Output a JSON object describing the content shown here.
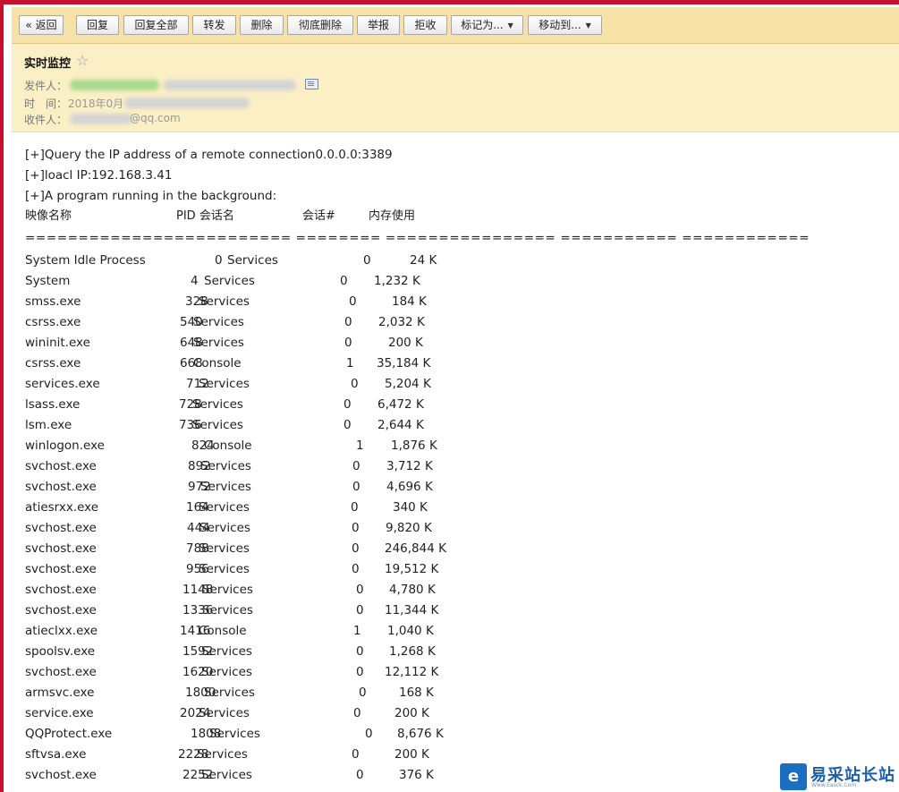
{
  "toolbar": {
    "back_label": "« 返回",
    "reply_label": "回复",
    "reply_all_label": "回复全部",
    "forward_label": "转发",
    "delete_label": "删除",
    "perm_delete_label": "彻底删除",
    "report_label": "举报",
    "reject_label": "拒收",
    "mark_as_label": "标记为...",
    "move_to_label": "移动到..."
  },
  "mail": {
    "subject": "实时监控",
    "star_icon": "☆",
    "from_label": "发件人：",
    "time_label": "时　间：",
    "time_value_visible": "2018年0月",
    "to_label": "收件人：",
    "to_value_visible": "@qq.com"
  },
  "body": {
    "line1": "[+]Query the IP address of a remote connection0.0.0.0:3389",
    "line2": "[+]loacl IP:192.168.3.41",
    "line3": "[+]A program running in the background:",
    "table_headers": {
      "image": "映像名称",
      "pid_session": "PID 会话名",
      "session_no": "会话#",
      "mem": "内存使用"
    },
    "separator": "========================= ======== ================ =========== ============",
    "processes": [
      {
        "name": "System Idle Process",
        "pid": "0",
        "session": "Services",
        "num": "0",
        "mem": "24 K"
      },
      {
        "name": "System",
        "pid": "4",
        "session": "Services",
        "num": "0",
        "mem": "1,232 K"
      },
      {
        "name": "smss.exe",
        "pid": "328",
        "session": "Services",
        "num": "0",
        "mem": "184 K"
      },
      {
        "name": "csrss.exe",
        "pid": "540",
        "session": "Services",
        "num": "0",
        "mem": "2,032 K"
      },
      {
        "name": "wininit.exe",
        "pid": "648",
        "session": "Services",
        "num": "0",
        "mem": "200 K"
      },
      {
        "name": "csrss.exe",
        "pid": "668",
        "session": "Console",
        "num": "1",
        "mem": "35,184 K"
      },
      {
        "name": "services.exe",
        "pid": "712",
        "session": "Services",
        "num": "0",
        "mem": "5,204 K"
      },
      {
        "name": "lsass.exe",
        "pid": "728",
        "session": "Services",
        "num": "0",
        "mem": "6,472 K"
      },
      {
        "name": "lsm.exe",
        "pid": "736",
        "session": "Services",
        "num": "0",
        "mem": "2,644 K"
      },
      {
        "name": "winlogon.exe",
        "pid": "824",
        "session": "Console",
        "num": "1",
        "mem": "1,876 K"
      },
      {
        "name": "svchost.exe",
        "pid": "892",
        "session": "Services",
        "num": "0",
        "mem": "3,712 K"
      },
      {
        "name": "svchost.exe",
        "pid": "972",
        "session": "Services",
        "num": "0",
        "mem": "4,696 K"
      },
      {
        "name": "atiesrxx.exe",
        "pid": "164",
        "session": "Services",
        "num": "0",
        "mem": "340 K"
      },
      {
        "name": "svchost.exe",
        "pid": "444",
        "session": "Services",
        "num": "0",
        "mem": "9,820 K"
      },
      {
        "name": "svchost.exe",
        "pid": "788",
        "session": "Services",
        "num": "0",
        "mem": "246,844 K"
      },
      {
        "name": "svchost.exe",
        "pid": "956",
        "session": "Services",
        "num": "0",
        "mem": "19,512 K"
      },
      {
        "name": "svchost.exe",
        "pid": "1148",
        "session": "Services",
        "num": "0",
        "mem": "4,780 K"
      },
      {
        "name": "svchost.exe",
        "pid": "1336",
        "session": "Services",
        "num": "0",
        "mem": "11,344 K"
      },
      {
        "name": "atieclxx.exe",
        "pid": "1416",
        "session": "Console",
        "num": "1",
        "mem": "1,040 K"
      },
      {
        "name": "spoolsv.exe",
        "pid": "1592",
        "session": "Services",
        "num": "0",
        "mem": "1,268 K"
      },
      {
        "name": "svchost.exe",
        "pid": "1620",
        "session": "Services",
        "num": "0",
        "mem": "12,112 K"
      },
      {
        "name": "armsvc.exe",
        "pid": "1800",
        "session": "Services",
        "num": "0",
        "mem": "168 K"
      },
      {
        "name": "service.exe",
        "pid": "2024",
        "session": "Services",
        "num": "0",
        "mem": "200 K"
      },
      {
        "name": "QQProtect.exe",
        "pid": "1808",
        "session": "Services",
        "num": "0",
        "mem": "8,676 K"
      },
      {
        "name": "sftvsa.exe",
        "pid": "2228",
        "session": "Services",
        "num": "0",
        "mem": "200 K"
      },
      {
        "name": "svchost.exe",
        "pid": "2252",
        "session": "Services",
        "num": "0",
        "mem": "376 K"
      }
    ]
  },
  "watermark": {
    "title": "易采站长站",
    "subtitle": "Www.Easck.Com"
  }
}
